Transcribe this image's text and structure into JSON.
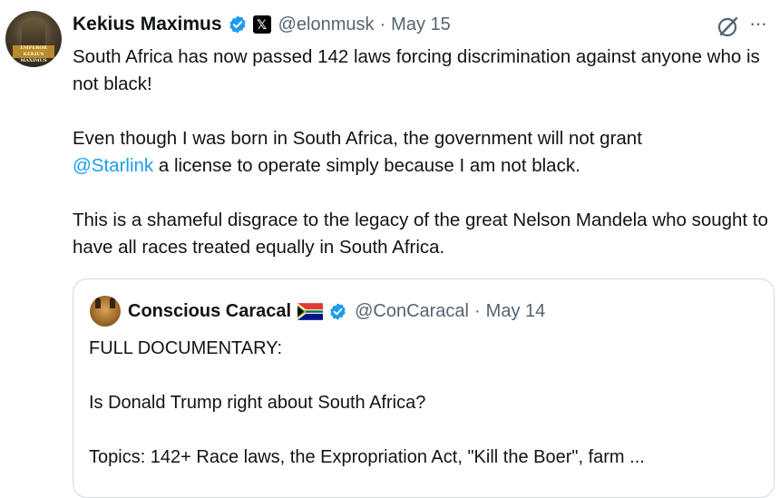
{
  "tweet": {
    "author_name": "Kekius Maximus",
    "handle": "@elonmusk",
    "separator": "·",
    "date": "May 15",
    "paragraphs": [
      "South Africa has now passed 142 laws forcing discrimination against anyone who is not black!",
      "Even though I was born in South Africa, the government will not grant",
      "This is a shameful disgrace to the legacy of the great Nelson Mandela who sought to have all races treated equally in South Africa."
    ],
    "mention": "@Starlink",
    "after_mention": " a license to operate simply because I am not black.",
    "avatar_banner_text": "EMPEROR KEKIUS MAXIMUS",
    "x_badge": "𝕏",
    "more_label": "···"
  },
  "quoted": {
    "author_name": "Conscious Caracal",
    "handle": "@ConCaracal",
    "separator": "·",
    "date": "May 14",
    "paragraphs": [
      "FULL DOCUMENTARY:",
      "Is Donald Trump right about South Africa?",
      "Topics: 142+ Race laws, the Expropriation Act, \"Kill the Boer\", farm ..."
    ]
  },
  "icons": {
    "verified": "verified-badge-icon",
    "x": "x-logo-icon",
    "grok": "grok-icon",
    "more": "more-options-icon",
    "flag": "south-africa-flag-icon"
  },
  "colors": {
    "verified": "#1d9bf0",
    "mention": "#1d9bf0",
    "secondary_text": "#536471"
  }
}
